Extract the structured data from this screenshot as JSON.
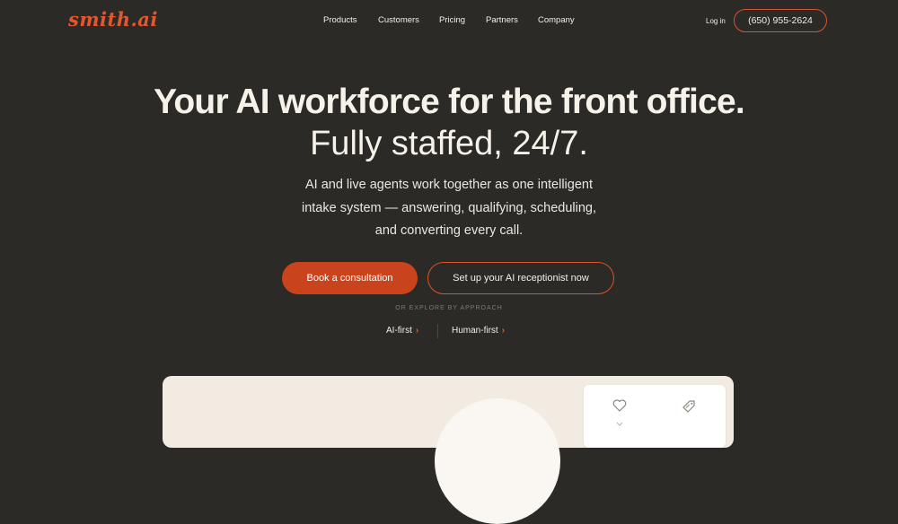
{
  "brand": {
    "logo": "smith.ai",
    "accent": "#e4572e",
    "background": "#2c2a27"
  },
  "nav": {
    "items": [
      "Products",
      "Customers",
      "Pricing",
      "Partners",
      "Company"
    ],
    "login": "Log in",
    "phone": "(650) 955-2624"
  },
  "hero": {
    "title": "Your AI workforce for the front office.",
    "subtitle": "Fully staffed, 24/7.",
    "description_lines": [
      "AI and live agents work together as one intelligent",
      "intake system — answering, qualifying, scheduling,",
      "and converting every call."
    ],
    "primary_cta": "Book a consultation",
    "secondary_cta": "Set up your AI receptionist now",
    "explore_label": "OR EXPLORE BY APPROACH",
    "approaches": [
      "AI-first",
      "Human-first"
    ]
  },
  "icons": {
    "card_icon_1": "heart-icon",
    "card_icon_2": "tag-icon"
  }
}
